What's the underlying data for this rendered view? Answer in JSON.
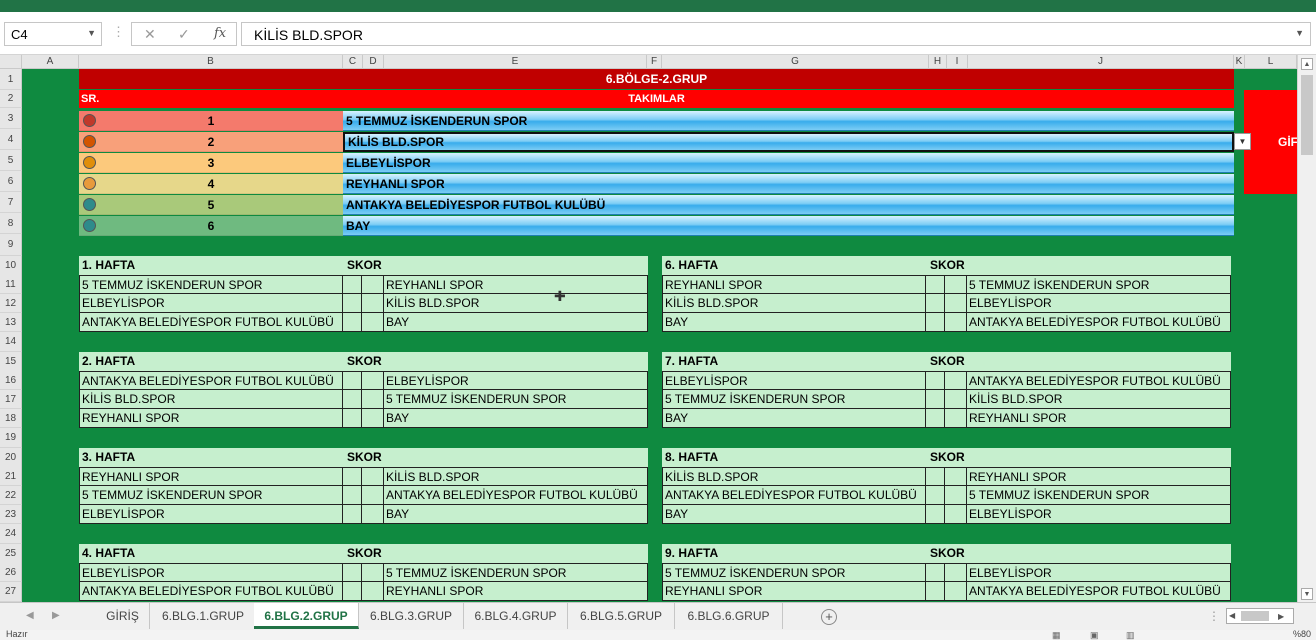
{
  "formula_bar": {
    "name_box": "C4",
    "formula": "KİLİS BLD.SPOR"
  },
  "columns": [
    "A",
    "B",
    "C",
    "D",
    "E",
    "F",
    "G",
    "H",
    "I",
    "J",
    "K",
    "L"
  ],
  "rows": [
    "1",
    "2",
    "3",
    "4",
    "5",
    "6",
    "7",
    "8",
    "9",
    "10",
    "11",
    "12",
    "13",
    "14",
    "15",
    "16",
    "17",
    "18",
    "19",
    "20",
    "21",
    "22",
    "23",
    "24",
    "25",
    "26",
    "27"
  ],
  "sheet": {
    "title": "6.BÖLGE-2.GRUP",
    "sr_header": "SR.",
    "teams_header": "TAKIMLAR",
    "side_button": "GİF",
    "teams": [
      {
        "num": "1",
        "name": "5 TEMMUZ İSKENDERUN SPOR",
        "color": "#f47a6c",
        "dot": "#c0392b"
      },
      {
        "num": "2",
        "name": "KİLİS BLD.SPOR",
        "color": "#f8a07a",
        "dot": "#d35400"
      },
      {
        "num": "3",
        "name": "ELBEYLİSPOR",
        "color": "#fcc97c",
        "dot": "#e08e0b"
      },
      {
        "num": "4",
        "name": "REYHANLI SPOR",
        "color": "#e6d78a",
        "dot": "#e89a3c"
      },
      {
        "num": "5",
        "name": "ANTAKYA BELEDİYESPOR FUTBOL KULÜBÜ",
        "color": "#a9c97a",
        "dot": "#2e8b8b"
      },
      {
        "num": "6",
        "name": "BAY",
        "color": "#6fba80",
        "dot": "#2e8b8b"
      }
    ],
    "score_label": "SKOR",
    "weeks_left": [
      {
        "name": "1. HAFTA",
        "matches": [
          [
            "5 TEMMUZ İSKENDERUN SPOR",
            "REYHANLI SPOR"
          ],
          [
            "ELBEYLİSPOR",
            "KİLİS BLD.SPOR"
          ],
          [
            "ANTAKYA BELEDİYESPOR FUTBOL KULÜBÜ",
            "BAY"
          ]
        ]
      },
      {
        "name": "2. HAFTA",
        "matches": [
          [
            "ANTAKYA BELEDİYESPOR FUTBOL KULÜBÜ",
            "ELBEYLİSPOR"
          ],
          [
            "KİLİS BLD.SPOR",
            "5 TEMMUZ İSKENDERUN SPOR"
          ],
          [
            "REYHANLI SPOR",
            "BAY"
          ]
        ]
      },
      {
        "name": "3. HAFTA",
        "matches": [
          [
            "REYHANLI SPOR",
            "KİLİS BLD.SPOR"
          ],
          [
            "5 TEMMUZ İSKENDERUN SPOR",
            "ANTAKYA BELEDİYESPOR FUTBOL KULÜBÜ"
          ],
          [
            "ELBEYLİSPOR",
            "BAY"
          ]
        ]
      },
      {
        "name": "4. HAFTA",
        "matches": [
          [
            "ELBEYLİSPOR",
            "5 TEMMUZ İSKENDERUN SPOR"
          ],
          [
            "ANTAKYA BELEDİYESPOR FUTBOL KULÜBÜ",
            "REYHANLI SPOR"
          ]
        ]
      }
    ],
    "weeks_right": [
      {
        "name": "6. HAFTA",
        "matches": [
          [
            "REYHANLI SPOR",
            "5 TEMMUZ İSKENDERUN SPOR"
          ],
          [
            "KİLİS BLD.SPOR",
            "ELBEYLİSPOR"
          ],
          [
            "BAY",
            "ANTAKYA BELEDİYESPOR FUTBOL KULÜBÜ"
          ]
        ]
      },
      {
        "name": "7. HAFTA",
        "matches": [
          [
            "ELBEYLİSPOR",
            "ANTAKYA BELEDİYESPOR FUTBOL KULÜBÜ"
          ],
          [
            "5 TEMMUZ İSKENDERUN SPOR",
            "KİLİS BLD.SPOR"
          ],
          [
            "BAY",
            "REYHANLI SPOR"
          ]
        ]
      },
      {
        "name": "8. HAFTA",
        "matches": [
          [
            "KİLİS BLD.SPOR",
            "REYHANLI SPOR"
          ],
          [
            "ANTAKYA BELEDİYESPOR FUTBOL KULÜBÜ",
            "5 TEMMUZ İSKENDERUN SPOR"
          ],
          [
            "BAY",
            "ELBEYLİSPOR"
          ]
        ]
      },
      {
        "name": "9. HAFTA",
        "matches": [
          [
            "5 TEMMUZ İSKENDERUN SPOR",
            "ELBEYLİSPOR"
          ],
          [
            "REYHANLI SPOR",
            "ANTAKYA BELEDİYESPOR FUTBOL KULÜBÜ"
          ]
        ]
      }
    ]
  },
  "tabs": [
    "GİRİŞ",
    "6.BLG.1.GRUP",
    "6.BLG.2.GRUP",
    "6.BLG.3.GRUP",
    "6.BLG.4.GRUP",
    "6.BLG.5.GRUP",
    "6.BLG.6.GRUP"
  ],
  "active_tab": "6.BLG.2.GRUP",
  "status": {
    "text": "Hazır",
    "zoom": "%80"
  }
}
